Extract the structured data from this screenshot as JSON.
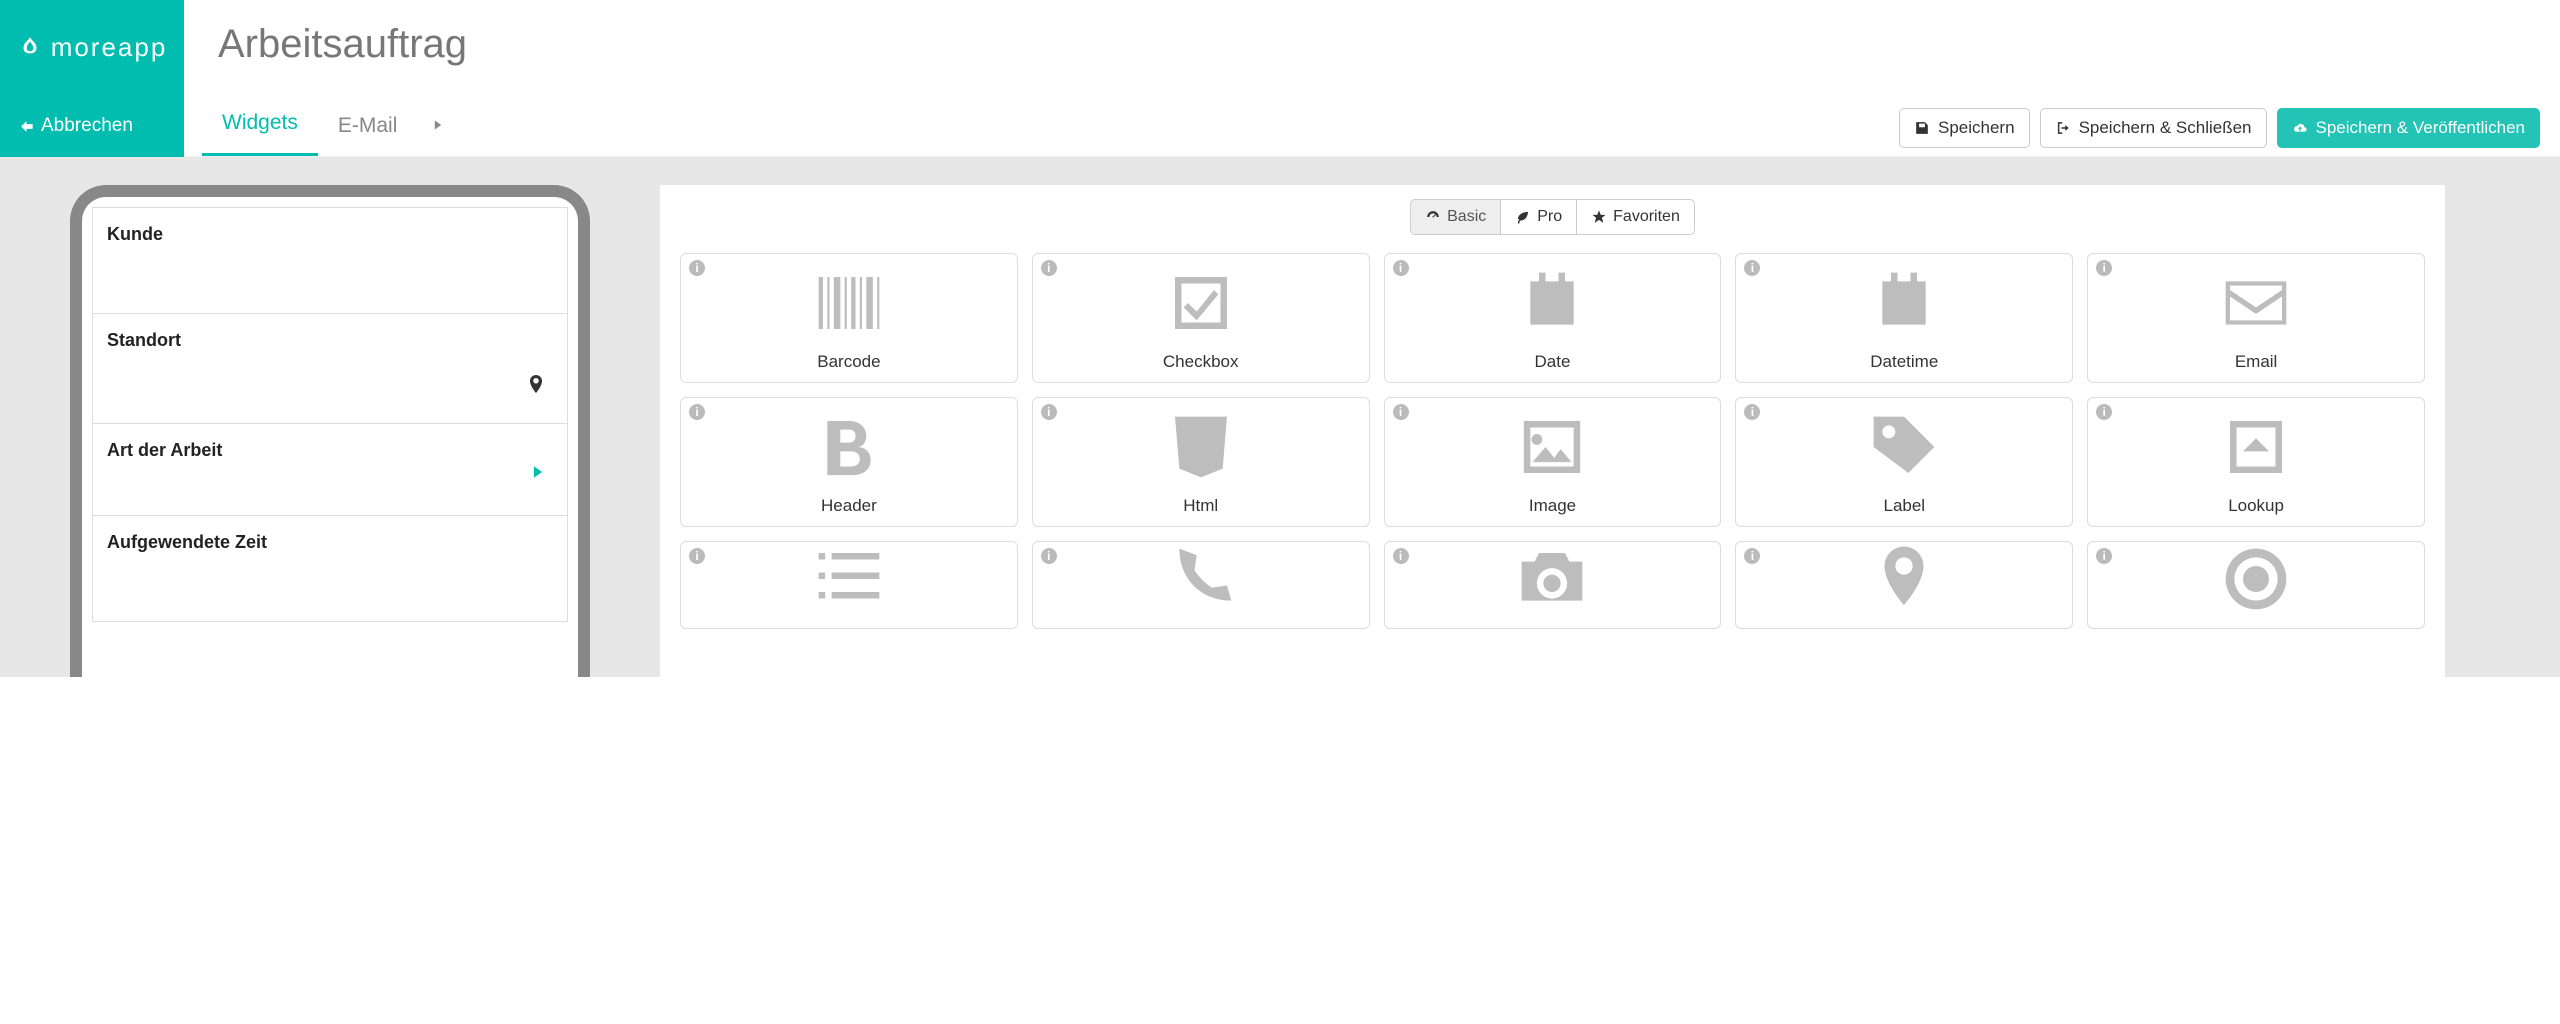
{
  "brand": "moreapp",
  "page_title": "Arbeitsauftrag",
  "cancel_label": "Abbrechen",
  "tabs": {
    "widgets": "Widgets",
    "email": "E-Mail"
  },
  "actions": {
    "save": "Speichern",
    "save_close": "Speichern & Schließen",
    "save_publish": "Speichern & Veröffentlichen"
  },
  "form_fields": {
    "kunde": "Kunde",
    "standort": "Standort",
    "art": "Art der Arbeit",
    "zeit": "Aufgewendete Zeit"
  },
  "filters": {
    "basic": "Basic",
    "pro": "Pro",
    "fav": "Favoriten"
  },
  "widgets": [
    {
      "id": "barcode",
      "label": "Barcode"
    },
    {
      "id": "checkbox",
      "label": "Checkbox"
    },
    {
      "id": "date",
      "label": "Date"
    },
    {
      "id": "datetime",
      "label": "Datetime"
    },
    {
      "id": "email",
      "label": "Email"
    },
    {
      "id": "header",
      "label": "Header"
    },
    {
      "id": "html",
      "label": "Html"
    },
    {
      "id": "image",
      "label": "Image"
    },
    {
      "id": "label",
      "label": "Label"
    },
    {
      "id": "lookup",
      "label": "Lookup"
    }
  ]
}
